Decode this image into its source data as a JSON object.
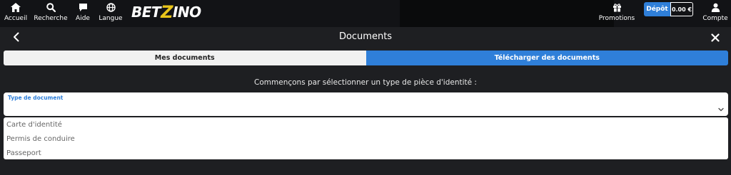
{
  "nav": {
    "items": [
      {
        "label": "Accueil",
        "icon": "home-icon"
      },
      {
        "label": "Recherche",
        "icon": "search-icon"
      },
      {
        "label": "Aide",
        "icon": "chat-icon"
      },
      {
        "label": "Langue",
        "icon": "globe-icon"
      }
    ],
    "logo_prefix": "BET",
    "logo_z": "Z",
    "logo_suffix": "INO",
    "promotions_label": "Promotions",
    "deposit_label": "Dépôt",
    "balance": "0.00 €",
    "account_label": "Compte"
  },
  "header": {
    "title": "Documents"
  },
  "tabs": [
    {
      "label": "Mes documents",
      "active": false
    },
    {
      "label": "Télécharger des documents",
      "active": true
    }
  ],
  "instruction": "Commençons par sélectionner un type de pièce d'identité :",
  "document_select": {
    "label": "Type de document",
    "value": "",
    "options": [
      "Carte d'identité",
      "Permis de conduire",
      "Passeport"
    ]
  },
  "colors": {
    "accent": "#2f7fd9",
    "background": "#1e1f22",
    "logo_z": "#e8c41a"
  }
}
